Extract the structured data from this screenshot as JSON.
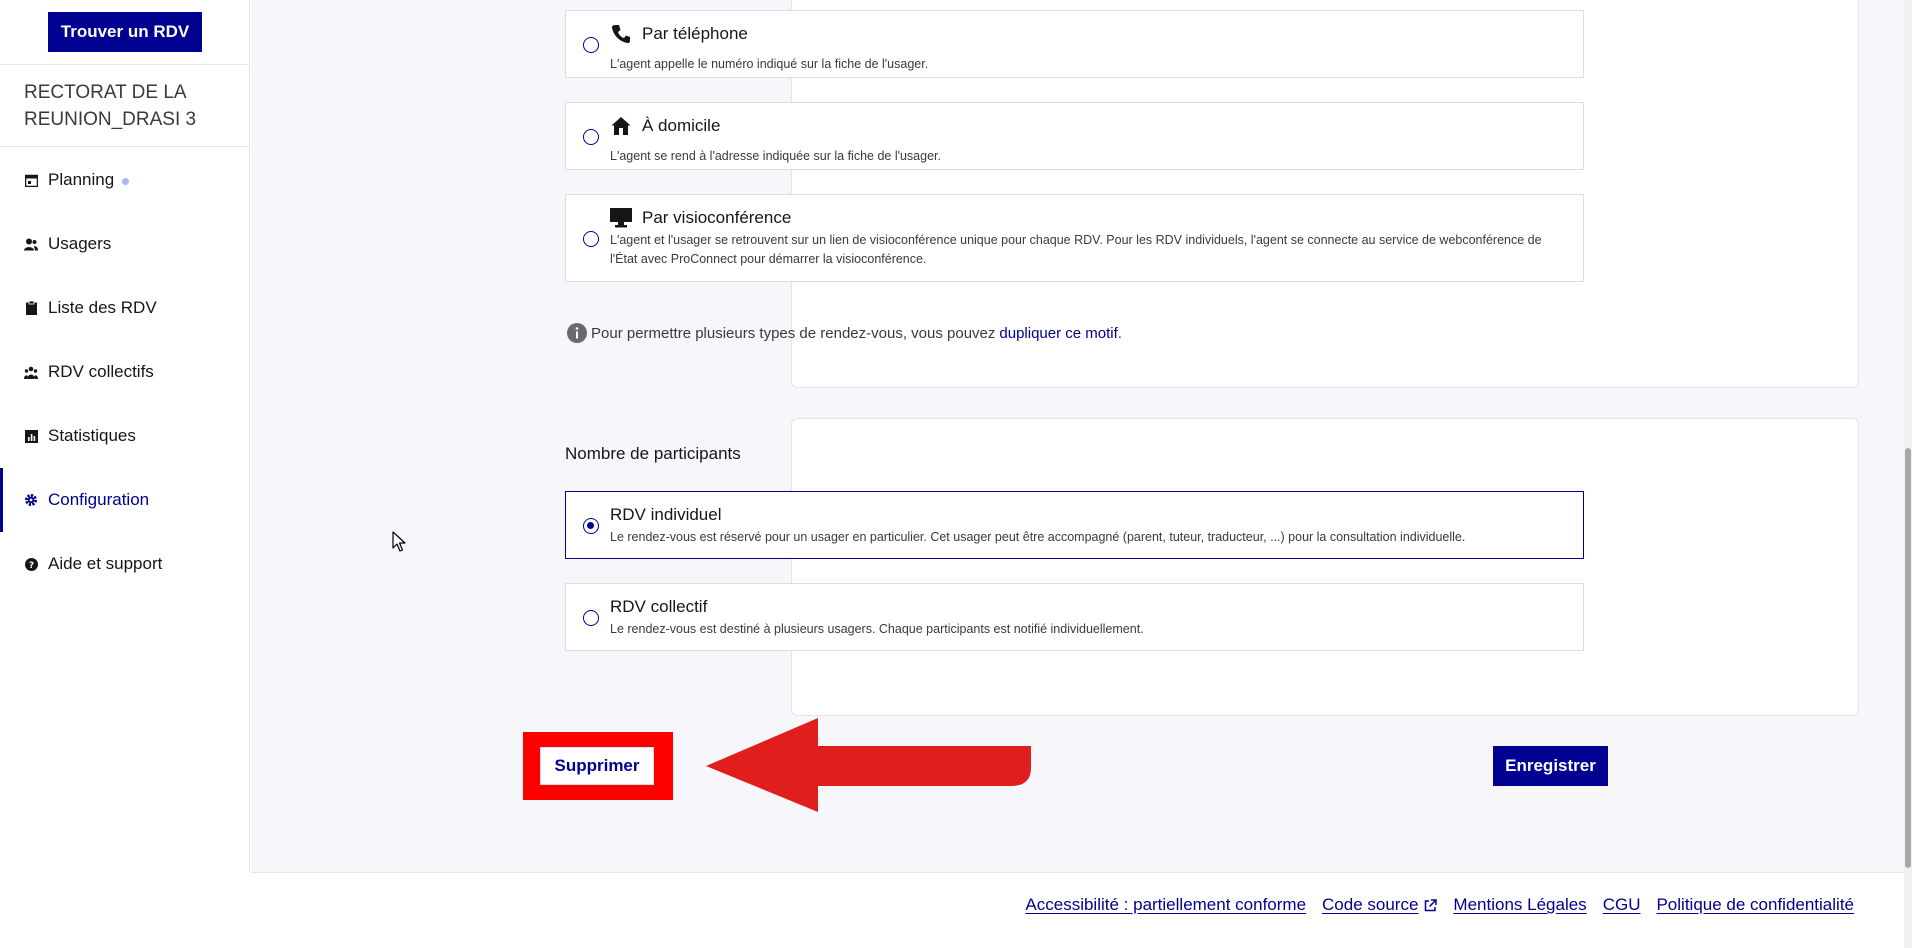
{
  "header": {
    "find_rdv_label": "Trouver un RDV"
  },
  "organisation": {
    "name": "RECTORAT DE LA REUNION_DRASI 3"
  },
  "sidebar": {
    "items": [
      {
        "label": "Planning",
        "icon": "calendar-icon",
        "has_dot": true
      },
      {
        "label": "Usagers",
        "icon": "users-icon"
      },
      {
        "label": "Liste des RDV",
        "icon": "clipboard-icon"
      },
      {
        "label": "RDV collectifs",
        "icon": "group-icon"
      },
      {
        "label": "Statistiques",
        "icon": "chart-icon"
      },
      {
        "label": "Configuration",
        "icon": "gear-icon",
        "active": true
      },
      {
        "label": "Aide et support",
        "icon": "question-icon"
      }
    ]
  },
  "location_options": [
    {
      "title": "Par téléphone",
      "icon": "phone-icon",
      "description": "L'agent appelle le numéro indiqué sur la fiche de l'usager."
    },
    {
      "title": "À domicile",
      "icon": "home-icon",
      "description": "L'agent se rend à l'adresse indiquée sur la fiche de l'usager."
    },
    {
      "title": "Par visioconférence",
      "icon": "monitor-icon",
      "description": "L'agent et l'usager se retrouvent sur un lien de visioconférence unique pour chaque RDV. Pour les RDV individuels, l'agent se connecte au service de webconférence de l'État avec ProConnect pour démarrer la visioconférence."
    }
  ],
  "info": {
    "text": "Pour permettre plusieurs types de rendez-vous, vous pouvez",
    "link": "dupliquer ce motif",
    "suffix": "."
  },
  "participants": {
    "title": "Nombre de participants",
    "options": [
      {
        "title": "RDV individuel",
        "selected": true,
        "description": "Le rendez-vous est réservé pour un usager en particulier. Cet usager peut être accompagné (parent, tuteur, traducteur, ...) pour la consultation individuelle."
      },
      {
        "title": "RDV collectif",
        "selected": false,
        "description": "Le rendez-vous est destiné à plusieurs usagers. Chaque participants est notifié individuellement."
      }
    ]
  },
  "actions": {
    "delete_label": "Supprimer",
    "save_label": "Enregistrer"
  },
  "footer": {
    "links": [
      "Accessibilité : partiellement conforme",
      "Code source",
      "Mentions Légales",
      "CGU",
      "Politique de confidentialité"
    ]
  },
  "colors": {
    "primary": "#000091",
    "annotation_red": "#ff0000",
    "arrow_red": "#e01e1e"
  }
}
